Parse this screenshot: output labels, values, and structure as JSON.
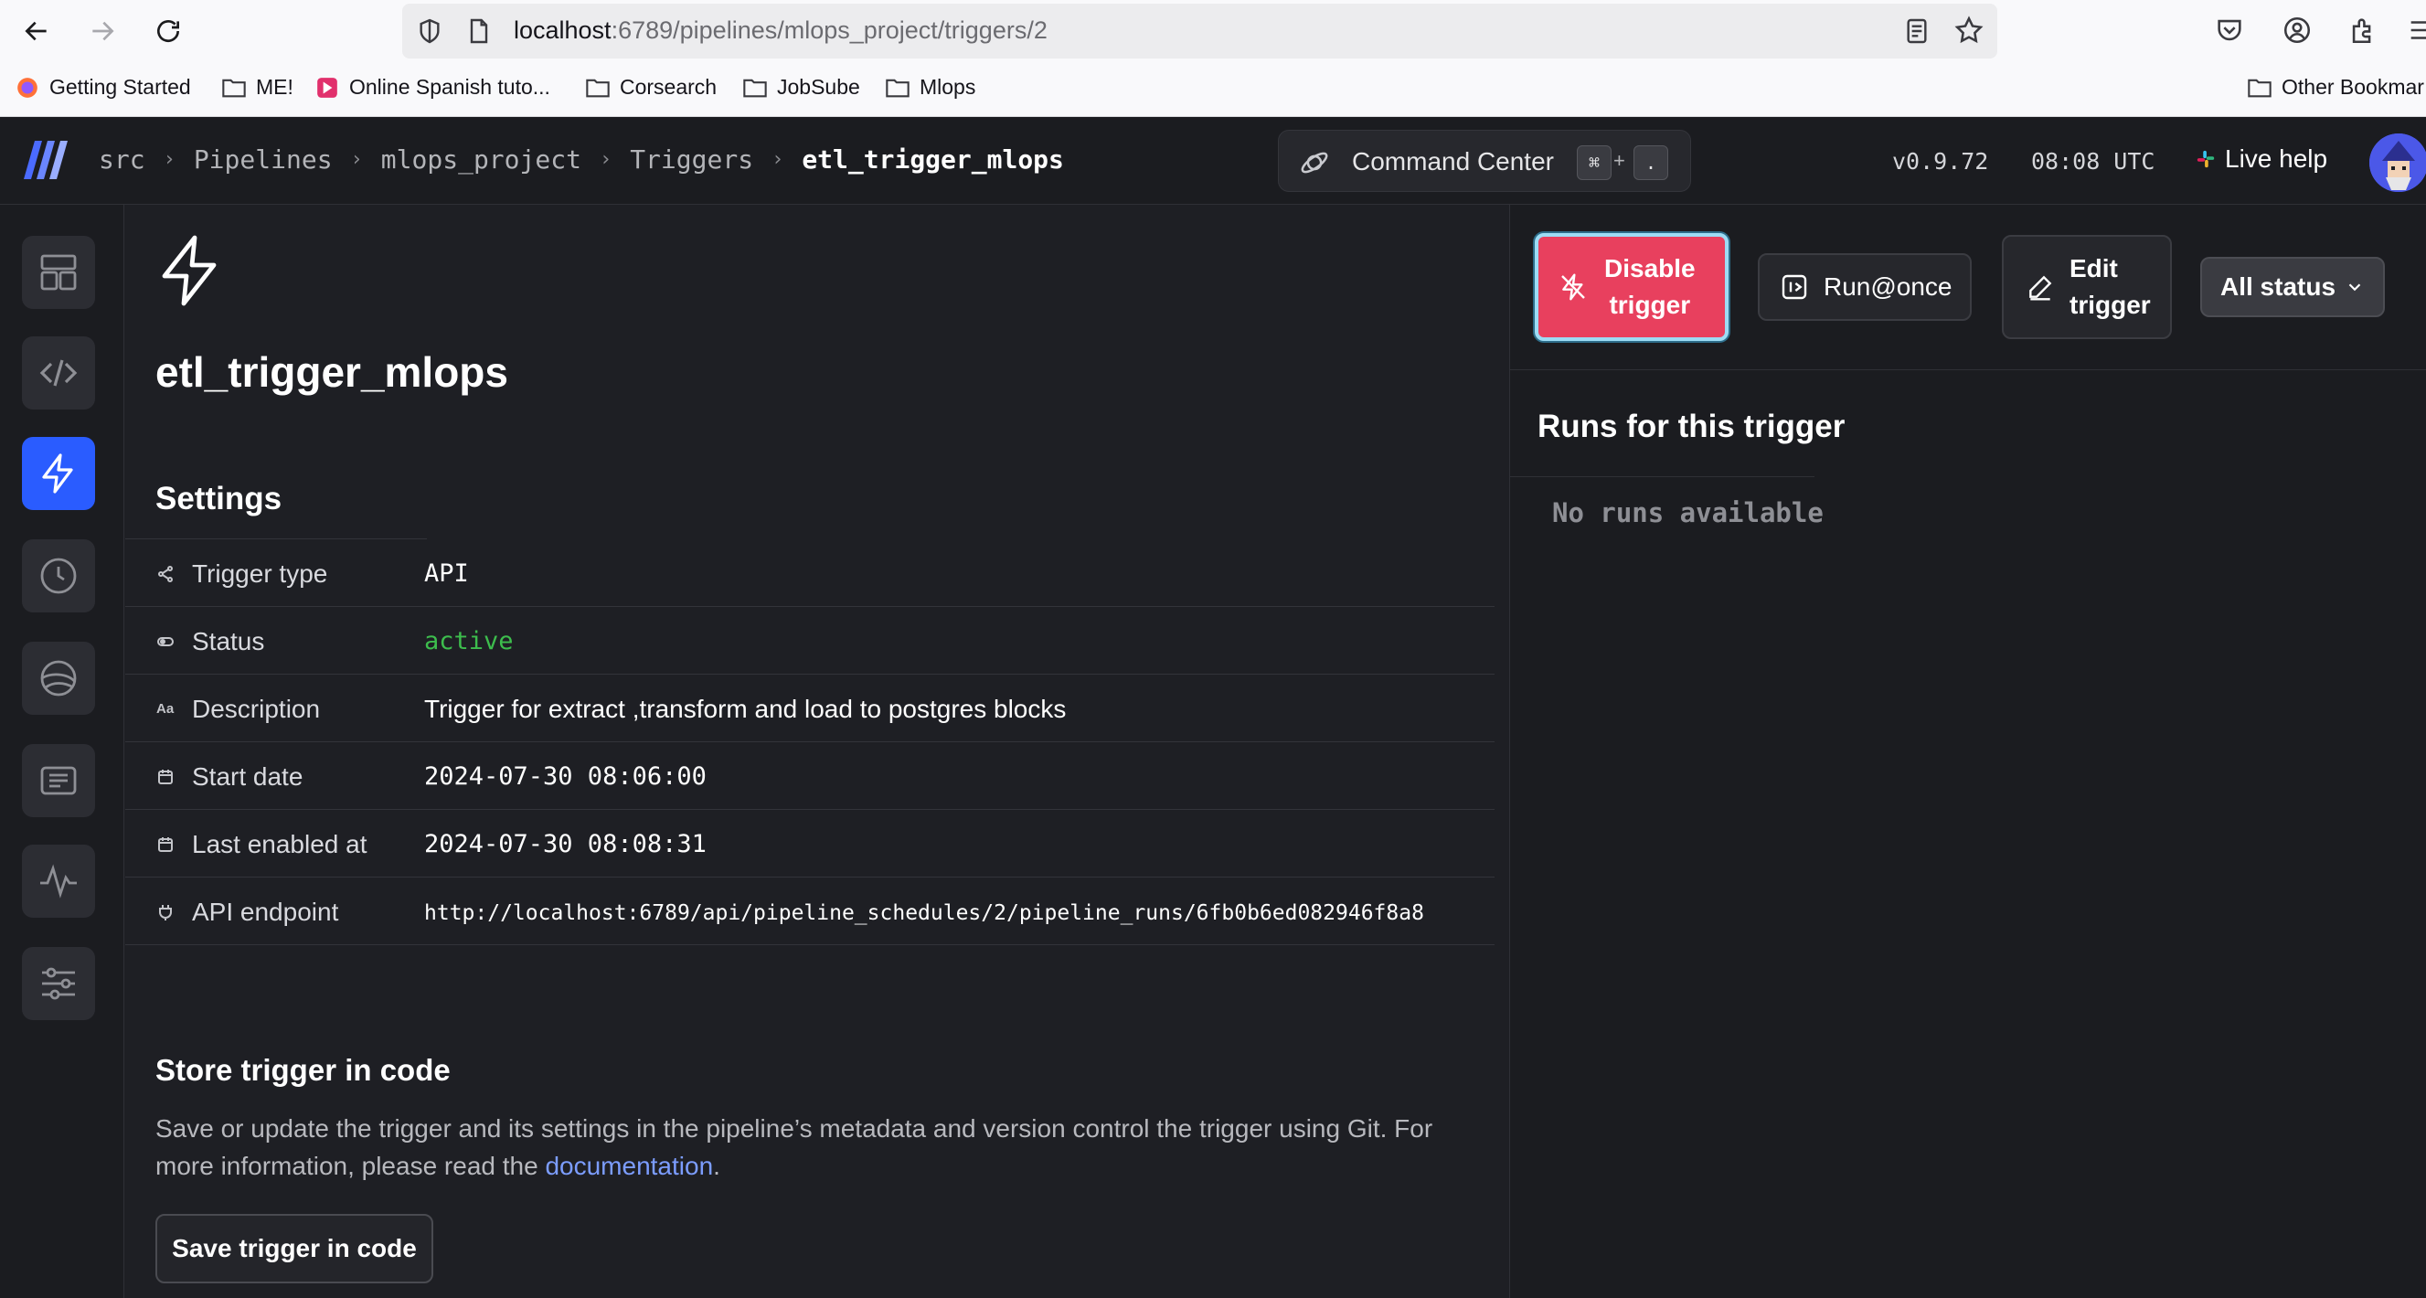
{
  "browser": {
    "url_host": "localhost",
    "url_path": ":6789/pipelines/mlops_project/triggers/2",
    "bookmarks": [
      "Getting Started",
      "ME!",
      "Online Spanish tuto...",
      "Corsearch",
      "JobSube",
      "Mlops",
      "Other Bookmar"
    ]
  },
  "header": {
    "breadcrumbs": [
      "src",
      "Pipelines",
      "mlops_project",
      "Triggers",
      "etl_trigger_mlops"
    ],
    "command_center": "Command Center",
    "shortcut_keys": [
      "⌘",
      "+",
      "."
    ],
    "version": "v0.9.72",
    "time": "08:08 UTC",
    "live_help": "Live help"
  },
  "trigger": {
    "name": "etl_trigger_mlops"
  },
  "settings": {
    "title": "Settings",
    "rows": [
      {
        "label": "Trigger type",
        "value": "API",
        "icon": "share-icon"
      },
      {
        "label": "Status",
        "value": "active",
        "icon": "toggle-icon"
      },
      {
        "label": "Description",
        "value": "Trigger for extract ,transform and load to postgres blocks",
        "icon": "text-icon"
      },
      {
        "label": "Start date",
        "value": "2024-07-30 08:06:00",
        "icon": "calendar-icon"
      },
      {
        "label": "Last enabled at",
        "value": "2024-07-30 08:08:31",
        "icon": "calendar-icon"
      },
      {
        "label": "API endpoint",
        "value": "http://localhost:6789/api/pipeline_schedules/2/pipeline_runs/6fb0b6ed082946f8a8",
        "icon": "plug-icon"
      }
    ],
    "icon_text_label": "Aa"
  },
  "store": {
    "title": "Store trigger in code",
    "text_before": "Save or update the trigger and its settings in the pipeline’s metadata and version control the trigger using Git. For more information, please read the ",
    "link": "documentation",
    "text_after": ".",
    "button": "Save trigger in code"
  },
  "actions": {
    "disable_line1": "Disable",
    "disable_line2": "trigger",
    "run_once": "Run@once",
    "edit_line1": "Edit",
    "edit_line2": "trigger",
    "status_filter": "All status"
  },
  "runs": {
    "title": "Runs for this trigger",
    "empty": "No runs available"
  },
  "colors": {
    "accent": "#2a5cff",
    "danger": "#e8405e",
    "active_status": "#3dbd4d",
    "link": "#7c9dff"
  }
}
